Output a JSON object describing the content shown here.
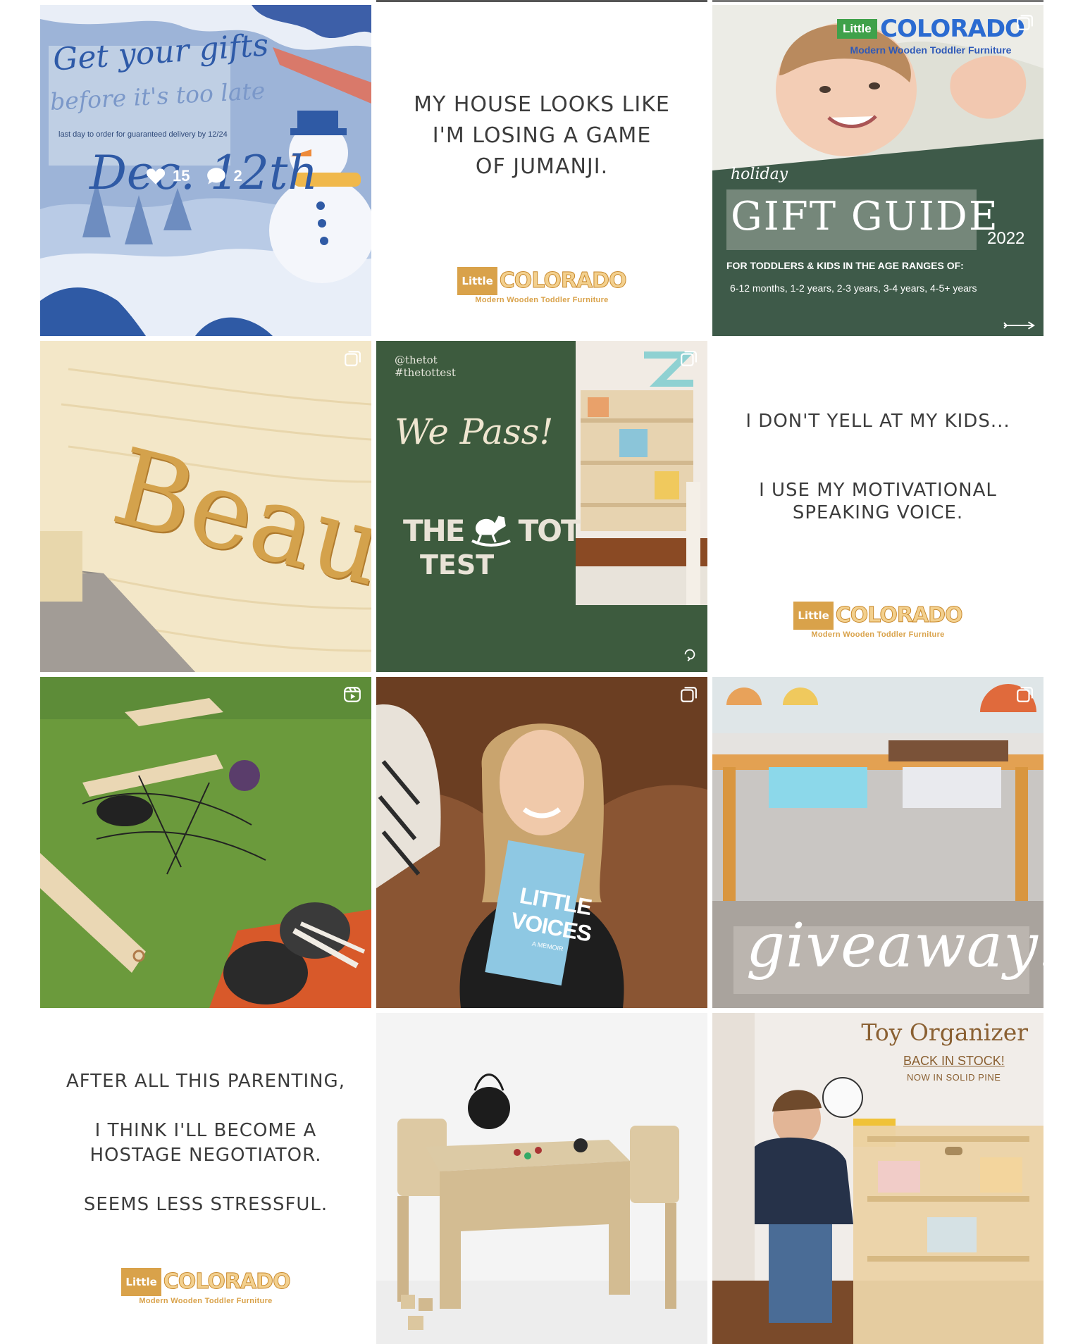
{
  "tiles": {
    "t1": {
      "headline_1": "Get your gifts",
      "headline_2": "before it's too late",
      "note": "last day to order for guaranteed delivery by 12/24",
      "date": "Dec. 12th",
      "likes": "15",
      "comments": "2",
      "like_icon": "heart-icon",
      "comment_icon": "comment-icon"
    },
    "t2": {
      "quote": [
        "MY HOUSE LOOKS LIKE",
        "I'M LOSING A GAME",
        "OF JUMANJI."
      ]
    },
    "t3": {
      "brand_little": "Little",
      "brand_name": "COLORADO",
      "brand_tagline": "Modern Wooden Toddler Furniture",
      "kicker": "holiday",
      "title": "GIFT GUIDE",
      "year": "2022",
      "subhead": "FOR TODDLERS & KIDS IN THE AGE RANGES OF:",
      "ages": "6-12 months, 1-2 years, 2-3 years, 3-4 years, 4-5+ years",
      "arrow_icon": "arrow-right-icon"
    },
    "t4": {
      "engraving": "Beau",
      "type_icon": "carousel-icon"
    },
    "t5": {
      "handle": "@thetot",
      "hashtag": "#thetottest",
      "script": "We Pass!",
      "logo_1a": "THE",
      "logo_1b": "TOT",
      "logo_2": "TEST",
      "type_icon": "carousel-icon",
      "loop_icon": "loop-icon"
    },
    "t6": {
      "line_1": "I DON'T YELL AT MY KIDS...",
      "line_2": "I USE MY MOTIVATIONAL",
      "line_3": "SPEAKING VOICE."
    },
    "t7": {
      "type_icon": "reels-icon"
    },
    "t8": {
      "book_1": "LITTLE",
      "book_2": "VOICES",
      "book_sub": "A MEMOIR",
      "type_icon": "carousel-icon"
    },
    "t9": {
      "script": "giveaway!",
      "type_icon": "carousel-icon"
    },
    "t10": {
      "lines": [
        "AFTER ALL THIS PARENTING,",
        "I THINK I'LL BECOME A",
        "HOSTAGE NEGOTIATOR.",
        "SEEMS LESS STRESSFUL."
      ]
    },
    "t11": {},
    "t12": {
      "title": "Toy Organizer",
      "badge": "BACK IN STOCK!",
      "sub": "NOW IN SOLID PINE"
    }
  },
  "logo": {
    "little": "Little",
    "name": "COLORADO",
    "tagline": "Modern Wooden Toddler Furniture"
  },
  "colors": {
    "brand_gold": "#d9a24a",
    "winter_blue": "#9bb3d6",
    "forest_green": "#3f5a48",
    "tot_green": "#3d5b3e"
  }
}
